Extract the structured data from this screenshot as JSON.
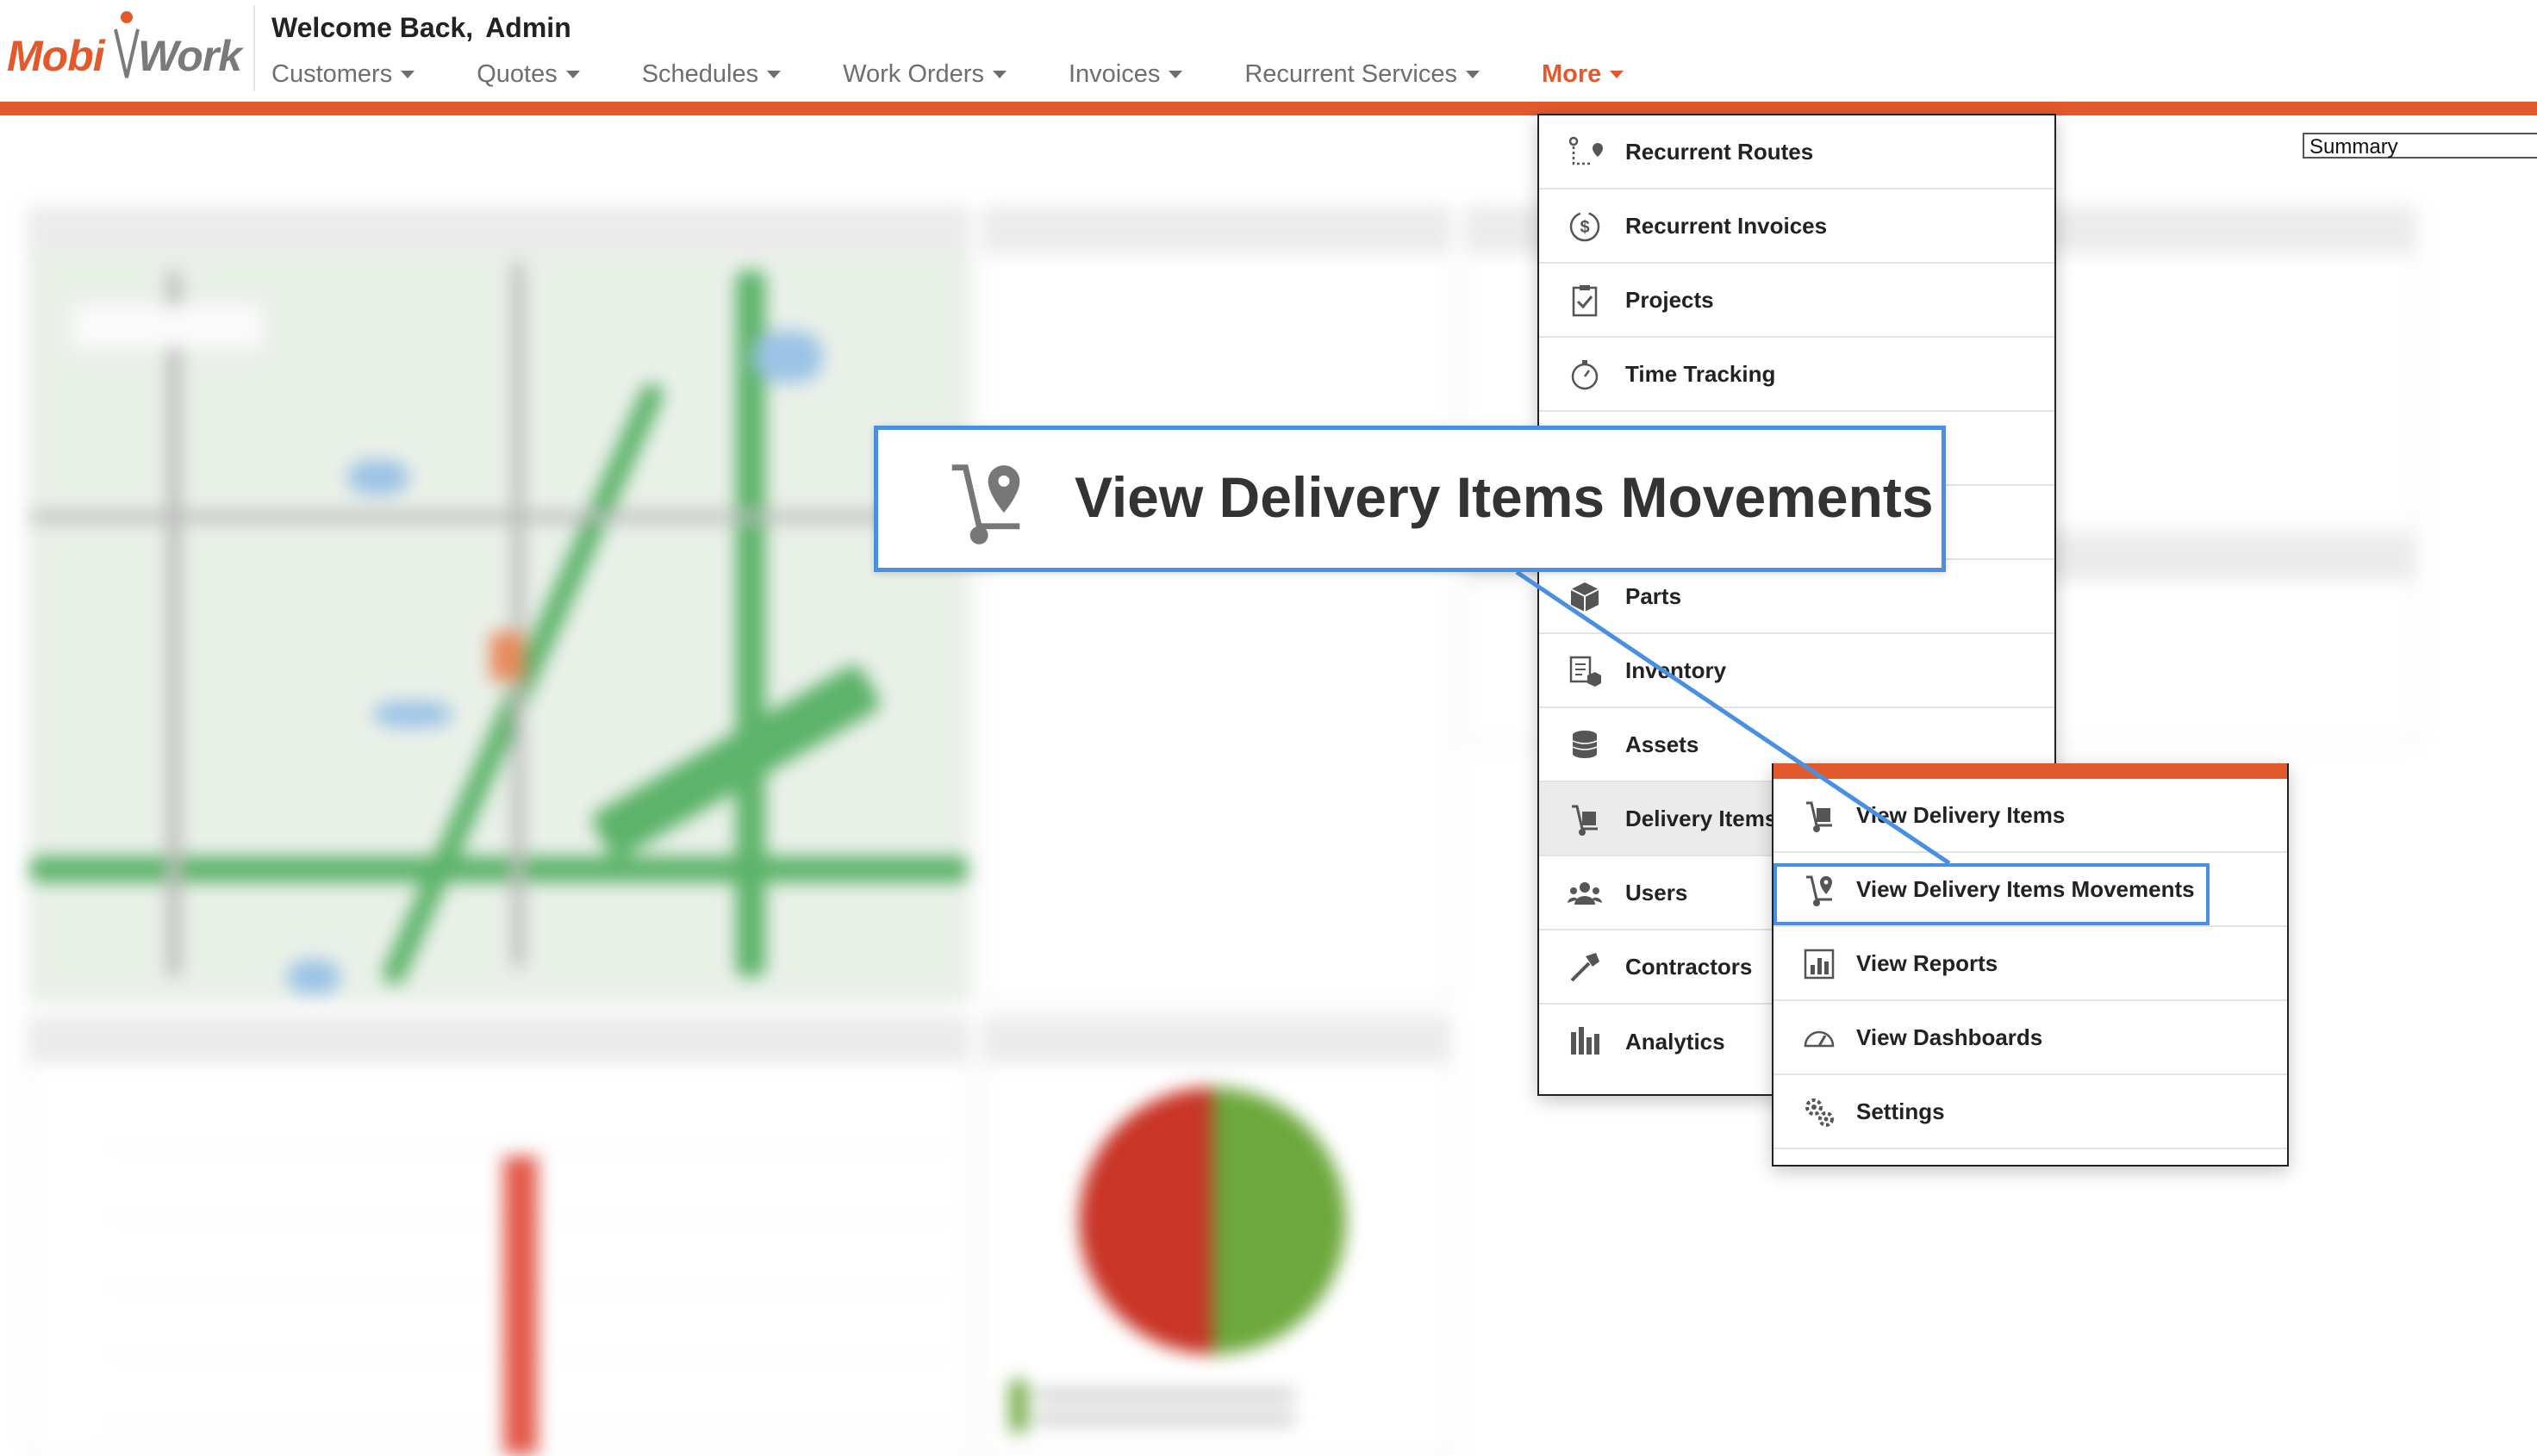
{
  "header": {
    "logo": {
      "part1": "Mobi",
      "part2": "Work"
    },
    "welcome_prefix": "Welcome Back,",
    "user_name": "Admin",
    "accent_color": "#e2592c"
  },
  "nav": [
    {
      "label": "Customers"
    },
    {
      "label": "Quotes"
    },
    {
      "label": "Schedules"
    },
    {
      "label": "Work Orders"
    },
    {
      "label": "Invoices"
    },
    {
      "label": "Recurrent Services"
    },
    {
      "label": "More",
      "active": true
    }
  ],
  "summary_select": {
    "value": "Summary"
  },
  "more_menu": {
    "items": [
      {
        "label": "Recurrent Routes",
        "icon": "route-icon"
      },
      {
        "label": "Recurrent Invoices",
        "icon": "dollar-cycle-icon"
      },
      {
        "label": "Projects",
        "icon": "clipboard-check-icon"
      },
      {
        "label": "Time Tracking",
        "icon": "stopwatch-icon"
      },
      {
        "label": "",
        "icon": ""
      },
      {
        "label": "",
        "icon": ""
      },
      {
        "label": "Parts",
        "icon": "box-icon"
      },
      {
        "label": "Inventory",
        "icon": "inventory-icon"
      },
      {
        "label": "Assets",
        "icon": "coins-stack-icon"
      },
      {
        "label": "Delivery Items",
        "icon": "hand-truck-icon",
        "hovered": true
      },
      {
        "label": "Users",
        "icon": "users-icon"
      },
      {
        "label": "Contractors",
        "icon": "hammer-icon"
      },
      {
        "label": "Analytics",
        "icon": "bar-chart-icon"
      }
    ]
  },
  "delivery_submenu": {
    "items": [
      {
        "label": "View Delivery Items",
        "icon": "hand-truck-icon"
      },
      {
        "label": "View Delivery Items Movements",
        "icon": "hand-truck-pin-icon",
        "highlighted": true
      },
      {
        "label": "View Reports",
        "icon": "report-chart-icon"
      },
      {
        "label": "View Dashboards",
        "icon": "gauge-icon"
      },
      {
        "label": "Settings",
        "icon": "gears-icon"
      }
    ]
  },
  "callout": {
    "label": "View Delivery Items Movements",
    "icon": "hand-truck-pin-icon",
    "color": "#4a90e2"
  }
}
